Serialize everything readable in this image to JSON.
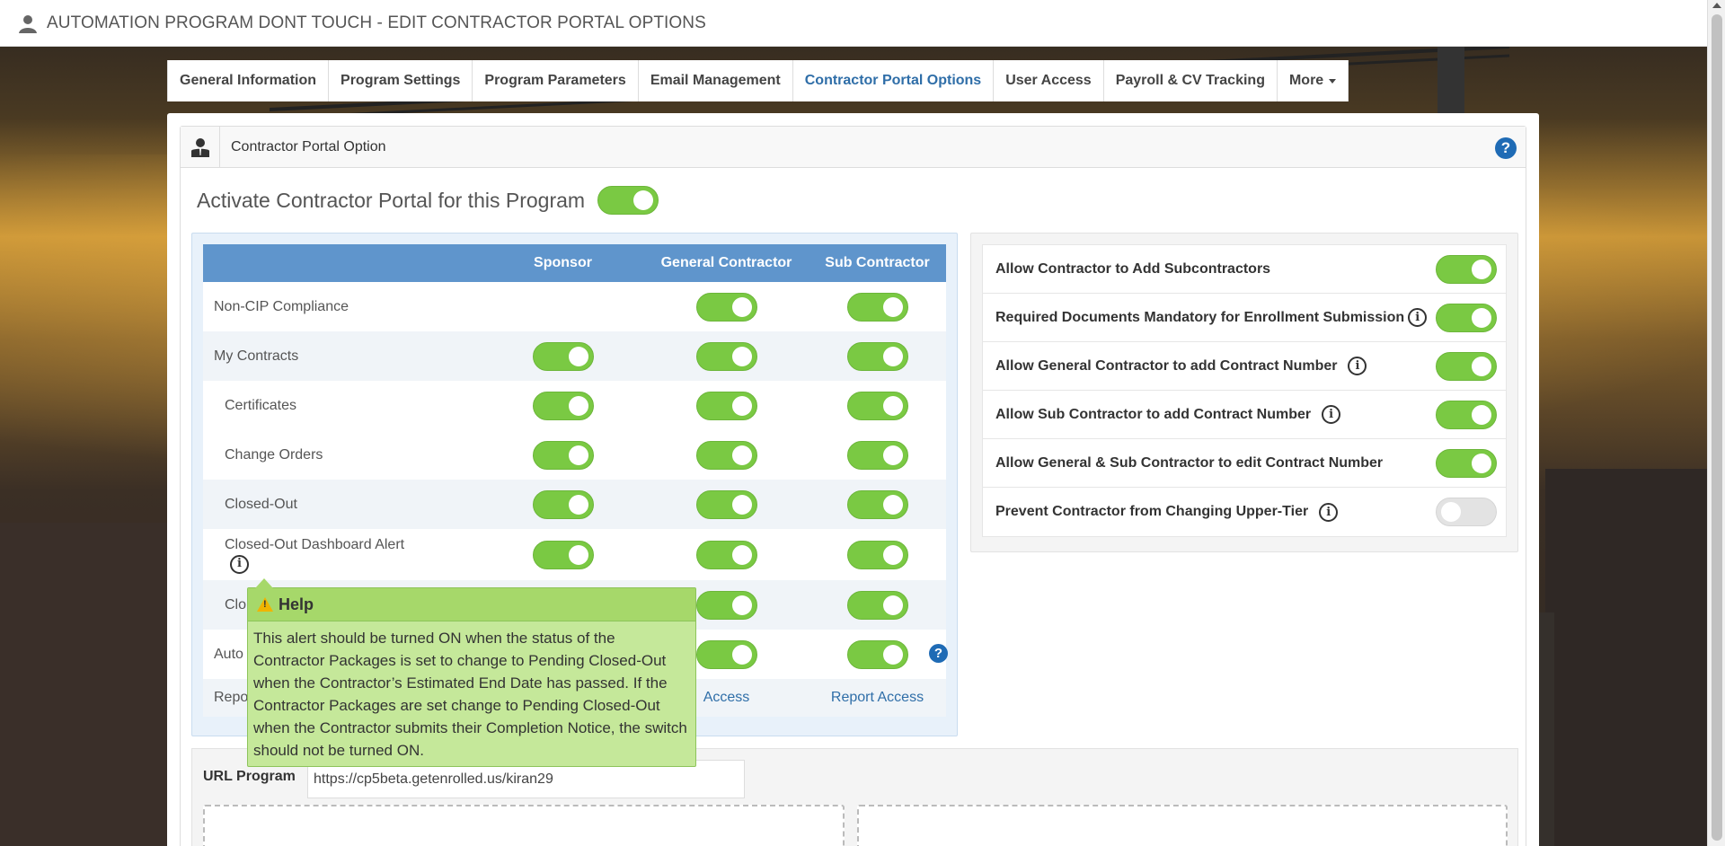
{
  "header": {
    "title": "AUTOMATION PROGRAM DONT TOUCH - EDIT CONTRACTOR PORTAL OPTIONS"
  },
  "tabs": [
    {
      "label": "General Information"
    },
    {
      "label": "Program Settings"
    },
    {
      "label": "Program Parameters"
    },
    {
      "label": "Email Management"
    },
    {
      "label": "Contractor Portal Options",
      "active": true
    },
    {
      "label": "User Access"
    },
    {
      "label": "Payroll & CV Tracking"
    },
    {
      "label": "More"
    }
  ],
  "card": {
    "title": "Contractor Portal Option",
    "help_glyph": "?"
  },
  "activate": {
    "label": "Activate Contractor Portal for this Program",
    "on": true
  },
  "grid": {
    "headers": [
      "",
      "Sponsor",
      "General Contractor",
      "Sub Contractor"
    ],
    "rows": [
      {
        "label": "Non-CIP Compliance",
        "sponsor": null,
        "gc": true,
        "sub": true
      },
      {
        "label": "My Contracts",
        "sponsor": true,
        "gc": true,
        "sub": true
      },
      {
        "label": "Certificates",
        "sponsor": true,
        "gc": true,
        "sub": true
      },
      {
        "label": "Change Orders",
        "sponsor": true,
        "gc": true,
        "sub": true
      },
      {
        "label": "Closed-Out",
        "sponsor": true,
        "gc": true,
        "sub": true
      },
      {
        "label": "Closed-Out Dashboard Alert",
        "sponsor": true,
        "gc": true,
        "sub": true
      },
      {
        "label": "Clo",
        "sponsor": null,
        "gc": true,
        "sub": true
      },
      {
        "label": "Auto",
        "sponsor": null,
        "gc": true,
        "sub": true
      },
      {
        "label": "Repo",
        "gc_link": "Access",
        "sub_link": "Report Access"
      }
    ],
    "info_glyph": "i",
    "help_glyph": "?"
  },
  "right_options": [
    {
      "label": "Allow Contractor to Add Subcontractors",
      "info": false,
      "on": true
    },
    {
      "label": "Required Documents Mandatory for Enrollment Submission",
      "info": true,
      "on": true
    },
    {
      "label": "Allow General Contractor to add Contract Number",
      "info": true,
      "on": true
    },
    {
      "label": "Allow Sub Contractor to add Contract Number",
      "info": true,
      "on": true
    },
    {
      "label": "Allow General & Sub Contractor to edit Contract Number",
      "info": false,
      "on": true
    },
    {
      "label": "Prevent Contractor from Changing Upper-Tier",
      "info": true,
      "on": false
    }
  ],
  "url": {
    "label": "URL Program",
    "value": "https://cp5beta.getenrolled.us/kiran29"
  },
  "popup": {
    "title": "Help",
    "text": "This alert should be turned ON when the status of the Contractor Packages is set to change to Pending Closed-Out when the Contractor’s Estimated End Date has passed. If the Contractor Packages are set change to Pending Closed-Out when the Contractor submits their Completion Notice, the switch should not be turned ON."
  },
  "colors": {
    "accent": "#2f6ea8",
    "toggle_on": "#7ac943",
    "header_blue": "#5f95cc",
    "popup_bg": "#c5e89a"
  }
}
